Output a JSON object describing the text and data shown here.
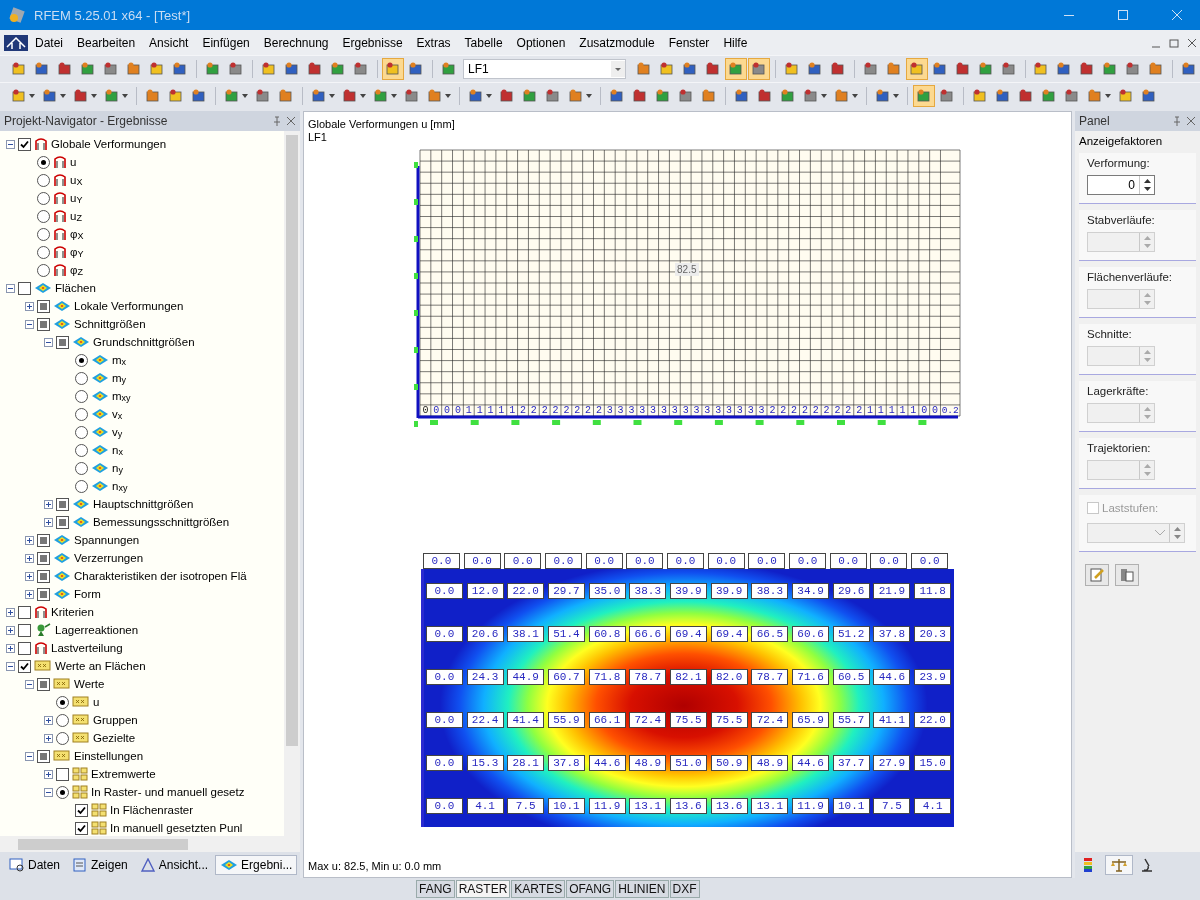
{
  "window": {
    "title": "RFEM 5.25.01 x64 - [Test*]"
  },
  "menu": [
    "Datei",
    "Bearbeiten",
    "Ansicht",
    "Einfügen",
    "Berechnung",
    "Ergebnisse",
    "Extras",
    "Tabelle",
    "Optionen",
    "Zusatzmodule",
    "Fenster",
    "Hilfe"
  ],
  "toolbar_1": [
    {
      "kind": "icon",
      "pressed": false
    },
    {
      "kind": "icon",
      "pressed": false
    },
    {
      "kind": "icon",
      "pressed": false
    },
    {
      "kind": "icon",
      "pressed": false
    },
    {
      "kind": "icon",
      "pressed": false
    },
    {
      "kind": "icon",
      "pressed": false
    },
    {
      "kind": "icon",
      "pressed": false
    },
    {
      "kind": "icon",
      "pressed": false
    },
    {
      "kind": "sep"
    },
    {
      "kind": "icon",
      "pressed": false
    },
    {
      "kind": "icon",
      "pressed": false
    },
    {
      "kind": "sep"
    },
    {
      "kind": "icon",
      "pressed": false
    },
    {
      "kind": "icon",
      "pressed": false
    },
    {
      "kind": "icon",
      "pressed": false
    },
    {
      "kind": "icon",
      "pressed": false
    },
    {
      "kind": "icon",
      "pressed": false
    },
    {
      "kind": "sep"
    },
    {
      "kind": "icon",
      "pressed": true
    },
    {
      "kind": "icon",
      "pressed": false
    },
    {
      "kind": "sep"
    },
    {
      "kind": "icon",
      "pressed": false
    },
    {
      "kind": "combo",
      "value": "LF1"
    },
    {
      "kind": "icon",
      "pressed": false
    },
    {
      "kind": "icon",
      "pressed": false
    },
    {
      "kind": "icon",
      "pressed": false
    },
    {
      "kind": "icon",
      "pressed": false
    },
    {
      "kind": "icon",
      "pressed": true
    },
    {
      "kind": "icon",
      "pressed": true
    },
    {
      "kind": "sep"
    },
    {
      "kind": "icon",
      "pressed": false
    },
    {
      "kind": "icon",
      "pressed": false
    },
    {
      "kind": "icon",
      "pressed": false
    },
    {
      "kind": "sep"
    },
    {
      "kind": "icon",
      "pressed": false
    },
    {
      "kind": "icon",
      "pressed": false
    },
    {
      "kind": "icon",
      "pressed": true
    },
    {
      "kind": "icon",
      "pressed": false
    },
    {
      "kind": "icon",
      "pressed": false
    },
    {
      "kind": "icon",
      "pressed": false
    },
    {
      "kind": "icon",
      "pressed": false
    },
    {
      "kind": "sep"
    },
    {
      "kind": "icon",
      "pressed": false
    },
    {
      "kind": "icon",
      "pressed": false
    },
    {
      "kind": "icon",
      "pressed": false
    },
    {
      "kind": "icon",
      "pressed": false
    },
    {
      "kind": "icon",
      "pressed": false
    },
    {
      "kind": "icon",
      "pressed": false
    },
    {
      "kind": "sep"
    },
    {
      "kind": "icon",
      "pressed": false
    }
  ],
  "toolbar_2": [
    {
      "kind": "icon",
      "pressed": false,
      "caret": true
    },
    {
      "kind": "icon",
      "pressed": false,
      "caret": true
    },
    {
      "kind": "icon",
      "pressed": false,
      "caret": true
    },
    {
      "kind": "icon",
      "pressed": false,
      "caret": true
    },
    {
      "kind": "sep"
    },
    {
      "kind": "icon",
      "pressed": false,
      "caret": false
    },
    {
      "kind": "icon",
      "pressed": false,
      "caret": false
    },
    {
      "kind": "icon",
      "pressed": false,
      "caret": false
    },
    {
      "kind": "sep"
    },
    {
      "kind": "icon",
      "pressed": false,
      "caret": true
    },
    {
      "kind": "icon",
      "pressed": false,
      "caret": false
    },
    {
      "kind": "icon",
      "pressed": false,
      "caret": false
    },
    {
      "kind": "sep"
    },
    {
      "kind": "icon",
      "pressed": false,
      "caret": true
    },
    {
      "kind": "icon",
      "pressed": false,
      "caret": true
    },
    {
      "kind": "icon",
      "pressed": false,
      "caret": true
    },
    {
      "kind": "icon",
      "pressed": false,
      "caret": false
    },
    {
      "kind": "icon",
      "pressed": false,
      "caret": true
    },
    {
      "kind": "sep"
    },
    {
      "kind": "icon",
      "pressed": false,
      "caret": true
    },
    {
      "kind": "icon",
      "pressed": false,
      "caret": false
    },
    {
      "kind": "icon",
      "pressed": false,
      "caret": false
    },
    {
      "kind": "icon",
      "pressed": false,
      "caret": false
    },
    {
      "kind": "icon",
      "pressed": false,
      "caret": true
    },
    {
      "kind": "sep"
    },
    {
      "kind": "icon",
      "pressed": false,
      "caret": false
    },
    {
      "kind": "icon",
      "pressed": false,
      "caret": false
    },
    {
      "kind": "icon",
      "pressed": false,
      "caret": false
    },
    {
      "kind": "icon",
      "pressed": false,
      "caret": false
    },
    {
      "kind": "icon",
      "pressed": false,
      "caret": false
    },
    {
      "kind": "sep"
    },
    {
      "kind": "icon",
      "pressed": false,
      "caret": false
    },
    {
      "kind": "icon",
      "pressed": false,
      "caret": false
    },
    {
      "kind": "icon",
      "pressed": false,
      "caret": false
    },
    {
      "kind": "icon",
      "pressed": false,
      "caret": true
    },
    {
      "kind": "icon",
      "pressed": false,
      "caret": true
    },
    {
      "kind": "sep"
    },
    {
      "kind": "icon",
      "pressed": false,
      "caret": true
    },
    {
      "kind": "sep"
    },
    {
      "kind": "icon",
      "pressed": true,
      "caret": false
    },
    {
      "kind": "icon",
      "pressed": false,
      "caret": false
    },
    {
      "kind": "sep"
    },
    {
      "kind": "icon",
      "pressed": false,
      "caret": false
    },
    {
      "kind": "icon",
      "pressed": false,
      "caret": false
    },
    {
      "kind": "icon",
      "pressed": false,
      "caret": false
    },
    {
      "kind": "icon",
      "pressed": false,
      "caret": false
    },
    {
      "kind": "icon",
      "pressed": false,
      "caret": false
    },
    {
      "kind": "icon",
      "pressed": false,
      "caret": true
    },
    {
      "kind": "icon",
      "pressed": false,
      "caret": false
    },
    {
      "kind": "icon",
      "pressed": false,
      "caret": false
    }
  ],
  "navigator": {
    "title": "Projekt-Navigator - Ergebnisse",
    "tree": [
      {
        "label": "Globale Verformungen",
        "checked": true,
        "partial": false,
        "kind": "deformation",
        "expanded": true,
        "children": [
          {
            "label": "u",
            "selected": true,
            "kind": "deformation"
          },
          {
            "label": "u$_{X}$",
            "selected": false,
            "kind": "deformation"
          },
          {
            "label": "u$_{Y}$",
            "selected": false,
            "kind": "deformation"
          },
          {
            "label": "u$_{Z}$",
            "selected": false,
            "kind": "deformation"
          },
          {
            "label": "φ$_{X}$",
            "selected": false,
            "kind": "deformation"
          },
          {
            "label": "φ$_{Y}$",
            "selected": false,
            "kind": "deformation"
          },
          {
            "label": "φ$_{Z}$",
            "selected": false,
            "kind": "deformation"
          }
        ]
      },
      {
        "label": "Flächen",
        "checked": false,
        "partial": false,
        "kind": "surface",
        "expanded": true,
        "children": [
          {
            "label": "Lokale Verformungen",
            "checked": false,
            "partial": true,
            "kind": "surface",
            "expanded": false
          },
          {
            "label": "Schnittgrößen",
            "checked": false,
            "partial": true,
            "kind": "surface",
            "expanded": true,
            "children": [
              {
                "label": "Grundschnittgrößen",
                "checked": false,
                "partial": true,
                "kind": "surface",
                "expanded": true,
                "children": [
                  {
                    "label": "m$_{x}$",
                    "selected": true,
                    "kind": "surface"
                  },
                  {
                    "label": "m$_{y}$",
                    "selected": false,
                    "kind": "surface"
                  },
                  {
                    "label": "m$_{xy}$",
                    "selected": false,
                    "kind": "surface"
                  },
                  {
                    "label": "v$_{x}$",
                    "selected": false,
                    "kind": "surface"
                  },
                  {
                    "label": "v$_{y}$",
                    "selected": false,
                    "kind": "surface"
                  },
                  {
                    "label": "n$_{x}$",
                    "selected": false,
                    "kind": "surface"
                  },
                  {
                    "label": "n$_{y}$",
                    "selected": false,
                    "kind": "surface"
                  },
                  {
                    "label": "n$_{xy}$",
                    "selected": false,
                    "kind": "surface"
                  }
                ]
              },
              {
                "label": "Hauptschnittgrößen",
                "checked": false,
                "partial": true,
                "kind": "surface",
                "expanded": false
              },
              {
                "label": "Bemessungsschnittgrößen",
                "checked": false,
                "partial": true,
                "kind": "surface",
                "expanded": false
              }
            ]
          },
          {
            "label": "Spannungen",
            "checked": false,
            "partial": true,
            "kind": "surface",
            "expanded": false
          },
          {
            "label": "Verzerrungen",
            "checked": false,
            "partial": true,
            "kind": "surface",
            "expanded": false
          },
          {
            "label": "Charakteristiken der isotropen Flä",
            "checked": false,
            "partial": true,
            "kind": "surface",
            "expanded": false
          },
          {
            "label": "Form",
            "checked": false,
            "partial": true,
            "kind": "surface",
            "expanded": false
          }
        ]
      },
      {
        "label": "Kriterien",
        "checked": false,
        "partial": false,
        "kind": "deformation",
        "expanded": false
      },
      {
        "label": "Lagerreaktionen",
        "checked": false,
        "partial": false,
        "kind": "support",
        "expanded": false
      },
      {
        "label": "Lastverteilung",
        "checked": false,
        "partial": false,
        "kind": "deformation",
        "expanded": false
      },
      {
        "label": "Werte an Flächen",
        "checked": true,
        "partial": false,
        "kind": "values",
        "expanded": true,
        "children": [
          {
            "label": "Werte",
            "checked": false,
            "partial": true,
            "kind": "values",
            "expanded": true,
            "children": [
              {
                "label": "u",
                "selected": true,
                "kind": "values"
              },
              {
                "label": "Gruppen",
                "selected": false,
                "kind": "values",
                "expanded": false
              },
              {
                "label": "Gezielte",
                "selected": false,
                "kind": "values",
                "expanded": false
              }
            ]
          },
          {
            "label": "Einstellungen",
            "checked": false,
            "partial": true,
            "kind": "values",
            "expanded": true,
            "children": [
              {
                "label": "Extremwerte",
                "checked": false,
                "partial": false,
                "kind": "grid",
                "expanded": false
              },
              {
                "label": "In Raster- und manuell gesetz",
                "selected": true,
                "kind": "grid",
                "expanded": true,
                "children": [
                  {
                    "label": "In Flächenraster",
                    "checked": true,
                    "partial": false,
                    "kind": "grid"
                  },
                  {
                    "label": "In manuell gesetzten Punl",
                    "checked": true,
                    "partial": false,
                    "kind": "grid"
                  }
                ]
              }
            ]
          }
        ]
      }
    ],
    "tabs": [
      {
        "label": "Daten",
        "selected": false
      },
      {
        "label": "Zeigen",
        "selected": false
      },
      {
        "label": "Ansicht...",
        "selected": false
      },
      {
        "label": "Ergebni...",
        "selected": true
      }
    ]
  },
  "view": {
    "title": "Globale Verformungen u [mm]",
    "load_case": "LF1",
    "mesh_max_label": "82.5",
    "mesh_bottom_row": [
      "0",
      "0",
      "0",
      "0",
      "1",
      "1",
      "1",
      "1",
      "1",
      "2",
      "2",
      "2",
      "2",
      "2",
      "2",
      "2",
      "2",
      "3",
      "3",
      "3",
      "3",
      "3",
      "3",
      "3",
      "3",
      "3",
      "3",
      "3",
      "3",
      "3",
      "3",
      "3",
      "2",
      "2",
      "2",
      "2",
      "2",
      "2",
      "2",
      "2",
      "2",
      "1",
      "1",
      "1",
      "1",
      "1",
      "0",
      "0",
      "0.2"
    ],
    "contour_top_row": [
      "0.0",
      "0.0",
      "0.0",
      "0.0",
      "0.0",
      "0.0",
      "0.0",
      "0.0",
      "0.0",
      "0.0",
      "0.0",
      "0.0",
      "0.0"
    ],
    "contour_rows": [
      [
        "0.0",
        "12.0",
        "22.0",
        "29.7",
        "35.0",
        "38.3",
        "39.9",
        "39.9",
        "38.3",
        "34.9",
        "29.6",
        "21.9",
        "11.8"
      ],
      [
        "0.0",
        "20.6",
        "38.1",
        "51.4",
        "60.8",
        "66.6",
        "69.4",
        "69.4",
        "66.5",
        "60.6",
        "51.2",
        "37.8",
        "20.3"
      ],
      [
        "0.0",
        "24.3",
        "44.9",
        "60.7",
        "71.8",
        "78.7",
        "82.1",
        "82.0",
        "78.7",
        "71.6",
        "60.5",
        "44.6",
        "23.9"
      ],
      [
        "0.0",
        "22.4",
        "41.4",
        "55.9",
        "66.1",
        "72.4",
        "75.5",
        "75.5",
        "72.4",
        "65.9",
        "55.7",
        "41.1",
        "22.0"
      ],
      [
        "0.0",
        "15.3",
        "28.1",
        "37.8",
        "44.6",
        "48.9",
        "51.0",
        "50.9",
        "48.9",
        "44.6",
        "37.7",
        "27.9",
        "15.0"
      ],
      [
        "0.0",
        "4.1",
        "7.5",
        "10.1",
        "11.9",
        "13.1",
        "13.6",
        "13.6",
        "13.1",
        "11.9",
        "10.1",
        "7.5",
        "4.1"
      ]
    ],
    "footer": "Max u: 82.5, Min u: 0.0 mm"
  },
  "panel": {
    "title": "Panel",
    "heading": "Anzeigefaktoren",
    "fields": [
      {
        "label": "Verformung:",
        "value": "0",
        "disabled": false
      },
      {
        "label": "Stabverläufe:",
        "disabled": true
      },
      {
        "label": "Flächenverläufe:",
        "disabled": true
      },
      {
        "label": "Schnitte:",
        "disabled": true
      },
      {
        "label": "Lagerkräfte:",
        "disabled": true
      },
      {
        "label": "Trajektorien:",
        "disabled": true
      }
    ],
    "load_steps": {
      "label": "Laststufen:",
      "checked": false,
      "disabled": true
    },
    "tabs": [
      {
        "selected": false
      },
      {
        "selected": true
      },
      {
        "selected": false
      }
    ]
  },
  "status_tabs": [
    {
      "label": "FANG",
      "selected": false
    },
    {
      "label": "RASTER",
      "selected": true
    },
    {
      "label": "KARTES",
      "selected": false
    },
    {
      "label": "OFANG",
      "selected": false
    },
    {
      "label": "HLINIEN",
      "selected": false
    },
    {
      "label": "DXF",
      "selected": false
    }
  ]
}
